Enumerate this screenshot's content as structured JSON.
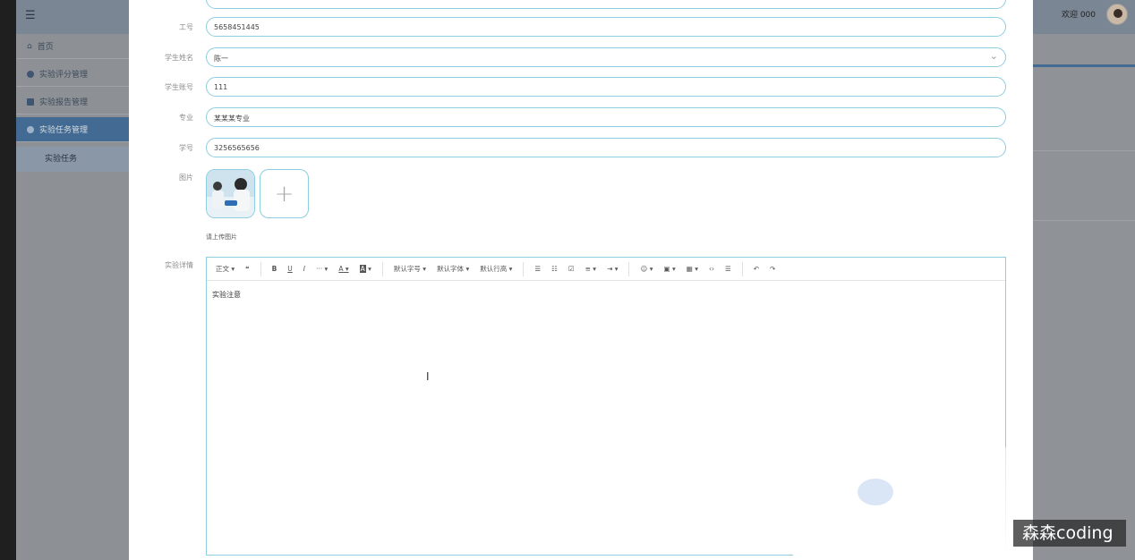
{
  "header": {
    "welcome_text": "欢迎 000"
  },
  "sidebar": {
    "items": [
      {
        "label": "首页"
      },
      {
        "label": "实验评分管理"
      },
      {
        "label": "实验报告管理"
      },
      {
        "label": "实验任务管理"
      }
    ],
    "active_sub": "实验任务"
  },
  "form": {
    "fields": [
      {
        "label": "工号",
        "value": "5658451445"
      },
      {
        "label": "学生姓名",
        "value": "陈一"
      },
      {
        "label": "学生账号",
        "value": "111"
      },
      {
        "label": "专业",
        "value": "某某某专业"
      },
      {
        "label": "学号",
        "value": "3256565656"
      }
    ],
    "image_label": "图片",
    "upload_hint": "请上传图片",
    "detail_label": "实验详情",
    "editor_content": "实验注意"
  },
  "editor_toolbar": {
    "items": [
      "正文",
      "❝",
      "B",
      "U",
      "I",
      "···",
      "A",
      "A",
      "默认字号",
      "默认字体",
      "默认行高",
      "☰",
      "☷",
      "☑",
      "≡",
      "⇥",
      "☺",
      "▣",
      "▦",
      "‹›",
      "☰",
      "↶",
      "↷"
    ]
  },
  "watermark": "森森coding",
  "colors": {
    "accent_border": "#8fcde0",
    "sidebar_active": "#426a93"
  }
}
